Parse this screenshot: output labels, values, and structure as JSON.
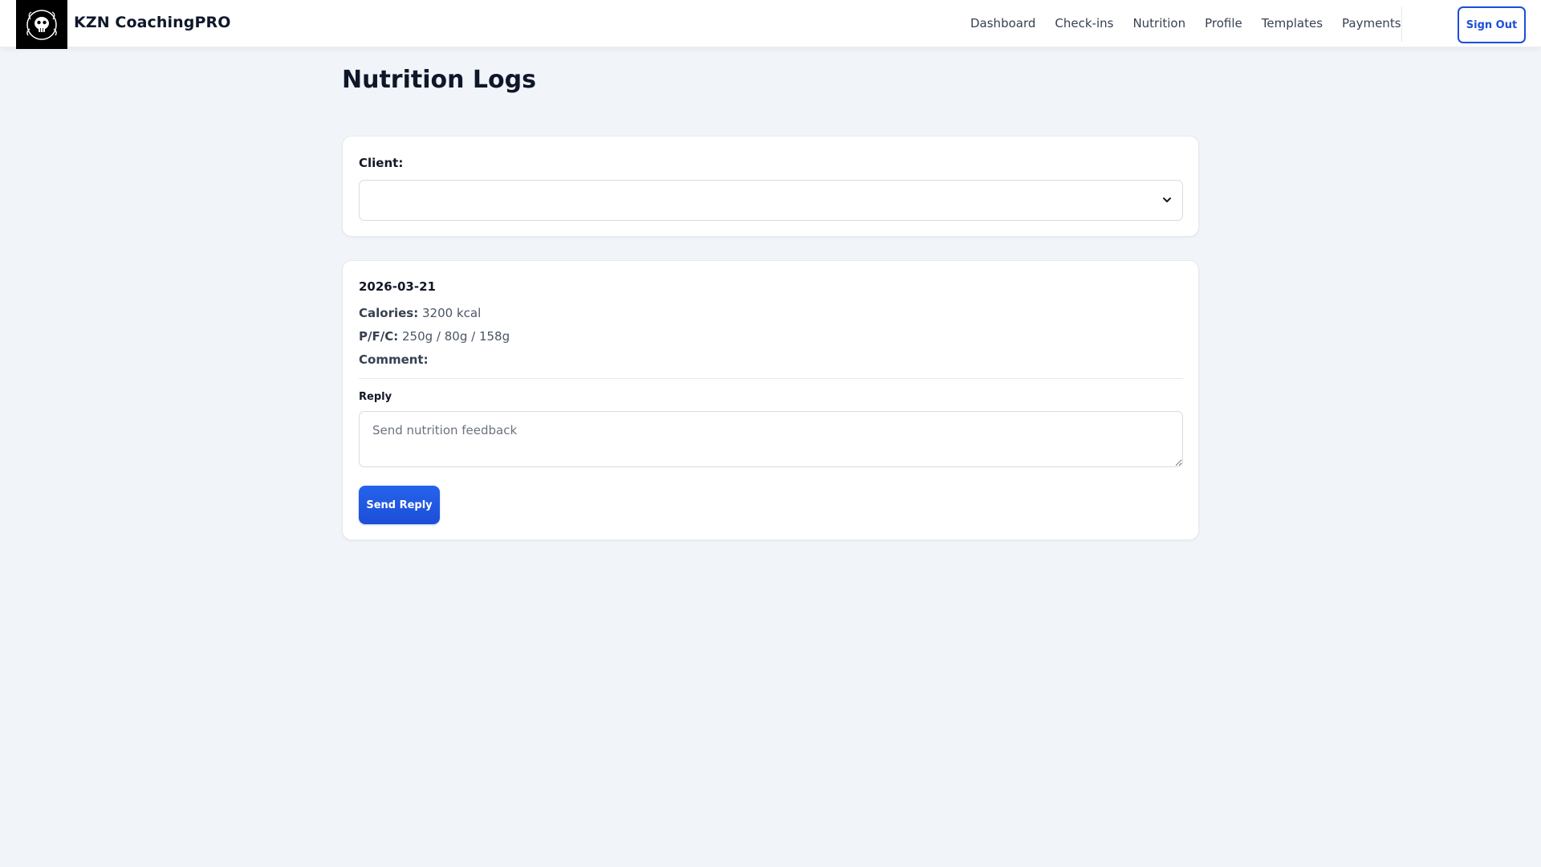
{
  "app": {
    "brand": "KZN CoachingPRO"
  },
  "nav": {
    "items": [
      "Dashboard",
      "Check-ins",
      "Nutrition",
      "Profile",
      "Templates",
      "Payments"
    ],
    "sign_out": "Sign Out"
  },
  "page": {
    "title": "Nutrition Logs"
  },
  "client_select": {
    "label": "Client:",
    "value": ""
  },
  "log": {
    "date": "2026-03-21",
    "calories_label": "Calories:",
    "calories_value": "3200 kcal",
    "pfc_label": "P/F/C:",
    "pfc_value": "250g / 80g / 158g",
    "comment_label": "Comment:",
    "comment_value": ""
  },
  "reply": {
    "label": "Reply",
    "placeholder": "Send nutrition feedback",
    "button": "Send Reply"
  },
  "colors": {
    "accent": "#1d4ed8",
    "background": "#f1f5f9",
    "card": "#ffffff"
  },
  "icons": {
    "logo": "skull-emblem-icon",
    "select_chevron": "chevron-down-icon"
  }
}
